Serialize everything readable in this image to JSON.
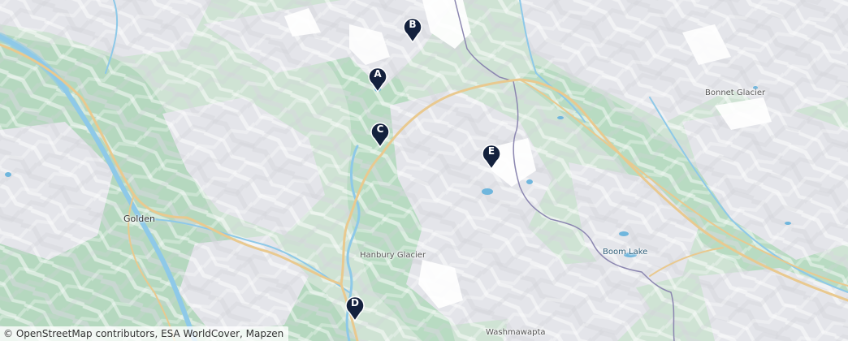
{
  "map": {
    "places": [
      {
        "id": "golden",
        "name": "Golden"
      },
      {
        "id": "hanbury",
        "name": "Hanbury Glacier"
      },
      {
        "id": "bonnet",
        "name": "Bonnet Glacier"
      },
      {
        "id": "boom",
        "name": "Boom Lake"
      },
      {
        "id": "washmawapta",
        "name": "Washmawapta"
      }
    ],
    "markers": [
      {
        "id": "a",
        "label": "A"
      },
      {
        "id": "b",
        "label": "B"
      },
      {
        "id": "c",
        "label": "C"
      },
      {
        "id": "d",
        "label": "D"
      },
      {
        "id": "e",
        "label": "E"
      }
    ],
    "attribution": "© OpenStreetMap contributors, ESA WorldCover, Mapzen",
    "colors": {
      "valley": "#cfe3d4",
      "forest": "#a9d0b4",
      "rock": "#e6e6ea",
      "snow": "#ffffff",
      "water": "#8ec9e8",
      "road": "#e9c98f",
      "border": "#8b86b0",
      "marker": "#14213d"
    }
  }
}
